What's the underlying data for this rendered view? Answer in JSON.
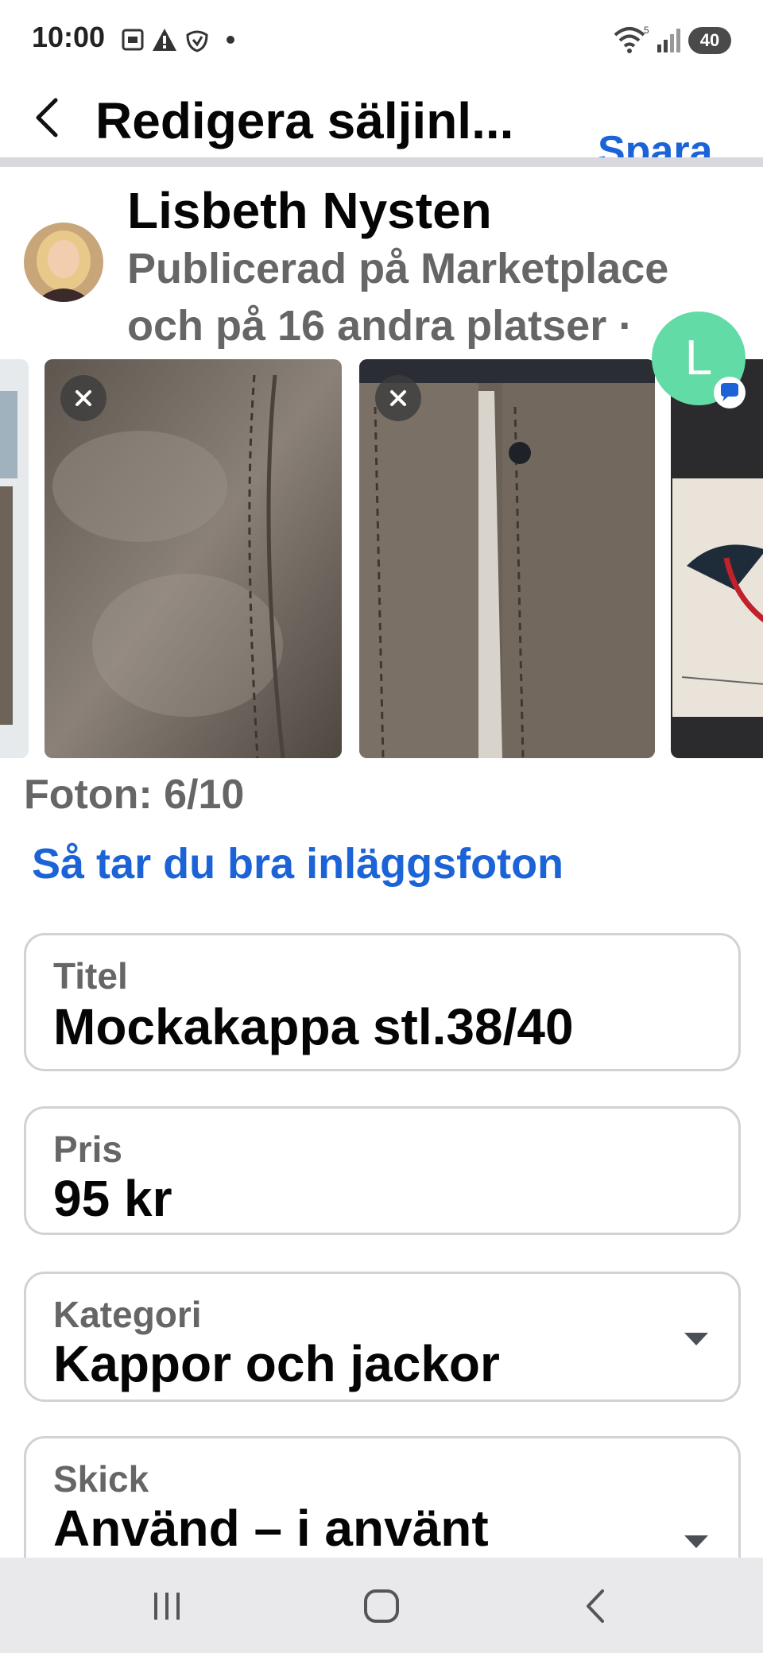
{
  "status_bar": {
    "time": "10:00",
    "battery": "40"
  },
  "header": {
    "title": "Redigera säljinl...",
    "save_label": "Spara"
  },
  "seller": {
    "name": "Lisbeth Nysten",
    "meta": "Publicerad på Marketplace och på 16 andra platser ·"
  },
  "photos": {
    "count_label": "Foton: 6/10",
    "tips_link": "Så tar du bra inläggsfoton"
  },
  "chat_head": {
    "initial": "L"
  },
  "fields": {
    "title": {
      "label": "Titel",
      "value": "Mockakappa stl.38/40"
    },
    "price": {
      "label": "Pris",
      "value": "95 kr"
    },
    "category": {
      "label": "Kategori",
      "value": "Kappor och jackor"
    },
    "condition": {
      "label": "Skick",
      "value": "Använd – i använt"
    }
  },
  "colors": {
    "accent": "#1b63d6",
    "chat_head": "#62dba6"
  }
}
